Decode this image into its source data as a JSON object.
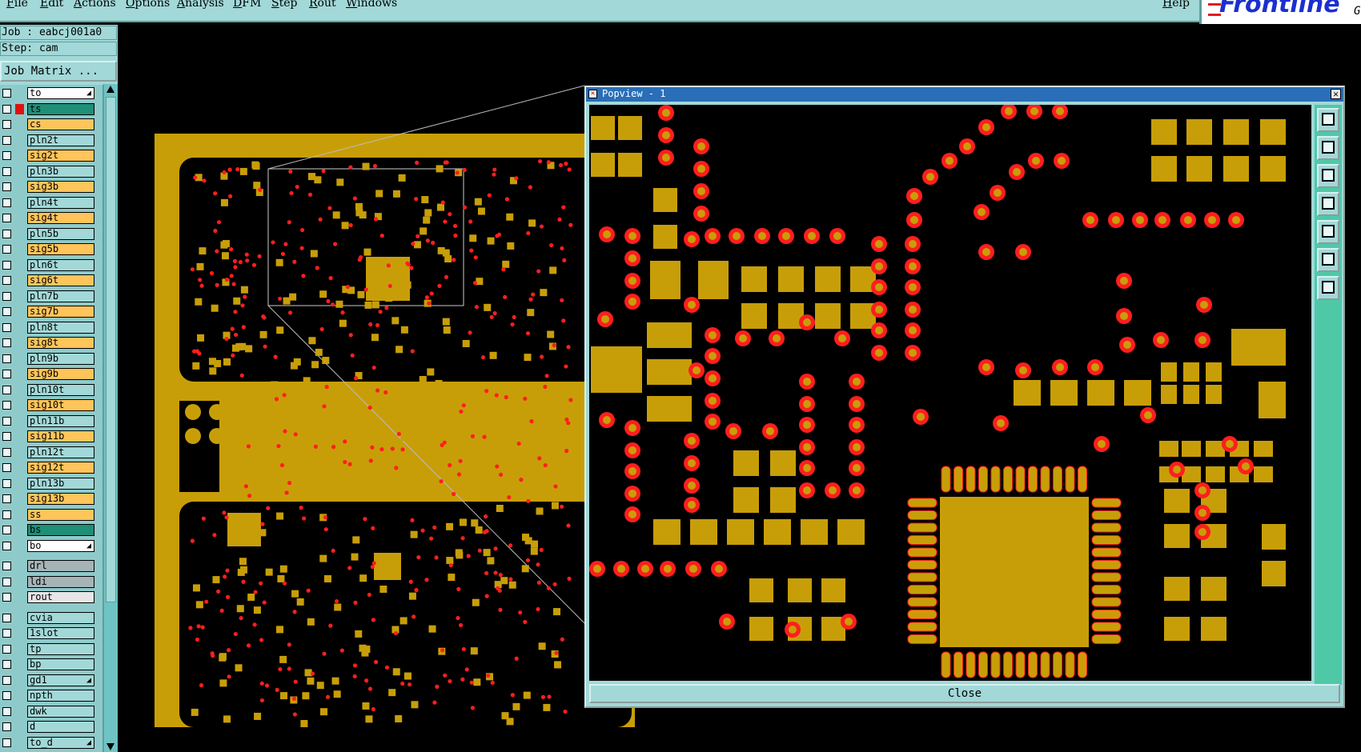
{
  "menubar": {
    "items": [
      "File",
      "Edit",
      "Actions",
      "Options",
      "Analysis",
      "DFM",
      "Step",
      "Rout",
      "Windows"
    ],
    "help": "Help"
  },
  "logo": {
    "text": "Frontline",
    "suffix": "G"
  },
  "job": {
    "label": "Job : eabcj001a0",
    "step": "Step: cam",
    "matrix_button": "Job Matrix ..."
  },
  "layers": [
    {
      "name": "to",
      "color": "white",
      "caret": true,
      "mark": ""
    },
    {
      "name": "ts",
      "color": "green",
      "caret": false,
      "mark": "red"
    },
    {
      "name": "cs",
      "color": "orange",
      "caret": false,
      "mark": ""
    },
    {
      "name": "pln2t",
      "color": "teal",
      "caret": false,
      "mark": ""
    },
    {
      "name": "sig2t",
      "color": "orange",
      "caret": false,
      "mark": ""
    },
    {
      "name": "pln3b",
      "color": "teal",
      "caret": false,
      "mark": ""
    },
    {
      "name": "sig3b",
      "color": "orange",
      "caret": false,
      "mark": ""
    },
    {
      "name": "pln4t",
      "color": "teal",
      "caret": false,
      "mark": ""
    },
    {
      "name": "sig4t",
      "color": "orange",
      "caret": false,
      "mark": ""
    },
    {
      "name": "pln5b",
      "color": "teal",
      "caret": false,
      "mark": ""
    },
    {
      "name": "sig5b",
      "color": "orange",
      "caret": false,
      "mark": ""
    },
    {
      "name": "pln6t",
      "color": "teal",
      "caret": false,
      "mark": ""
    },
    {
      "name": "sig6t",
      "color": "orange",
      "caret": false,
      "mark": ""
    },
    {
      "name": "pln7b",
      "color": "teal",
      "caret": false,
      "mark": ""
    },
    {
      "name": "sig7b",
      "color": "orange",
      "caret": false,
      "mark": ""
    },
    {
      "name": "pln8t",
      "color": "teal",
      "caret": false,
      "mark": ""
    },
    {
      "name": "sig8t",
      "color": "orange",
      "caret": false,
      "mark": ""
    },
    {
      "name": "pln9b",
      "color": "teal",
      "caret": false,
      "mark": ""
    },
    {
      "name": "sig9b",
      "color": "orange",
      "caret": false,
      "mark": ""
    },
    {
      "name": "pln10t",
      "color": "teal",
      "caret": false,
      "mark": ""
    },
    {
      "name": "sig10t",
      "color": "orange",
      "caret": false,
      "mark": ""
    },
    {
      "name": "pln11b",
      "color": "teal",
      "caret": false,
      "mark": ""
    },
    {
      "name": "sig11b",
      "color": "orange",
      "caret": false,
      "mark": ""
    },
    {
      "name": "pln12t",
      "color": "teal",
      "caret": false,
      "mark": ""
    },
    {
      "name": "sig12t",
      "color": "orange",
      "caret": false,
      "mark": ""
    },
    {
      "name": "pln13b",
      "color": "teal",
      "caret": false,
      "mark": ""
    },
    {
      "name": "sig13b",
      "color": "orange",
      "caret": false,
      "mark": ""
    },
    {
      "name": "ss",
      "color": "orange",
      "caret": false,
      "mark": ""
    },
    {
      "name": "bs",
      "color": "green",
      "caret": false,
      "mark": ""
    },
    {
      "name": "bo",
      "color": "white",
      "caret": true,
      "mark": ""
    },
    {
      "name": "drl",
      "color": "grey",
      "caret": false,
      "mark": "",
      "gap": true
    },
    {
      "name": "ldi",
      "color": "grey",
      "caret": false,
      "mark": ""
    },
    {
      "name": "rout",
      "color": "lightgrey",
      "caret": false,
      "mark": ""
    },
    {
      "name": "cvia",
      "color": "teal",
      "caret": false,
      "mark": "",
      "gap": true
    },
    {
      "name": "1slot",
      "color": "teal",
      "caret": false,
      "mark": ""
    },
    {
      "name": "tp",
      "color": "teal",
      "caret": false,
      "mark": ""
    },
    {
      "name": "bp",
      "color": "teal",
      "caret": false,
      "mark": ""
    },
    {
      "name": "gd1",
      "color": "teal",
      "caret": true,
      "mark": ""
    },
    {
      "name": "npth",
      "color": "teal",
      "caret": false,
      "mark": ""
    },
    {
      "name": "dwk",
      "color": "teal",
      "caret": false,
      "mark": ""
    },
    {
      "name": "d",
      "color": "teal",
      "caret": false,
      "mark": ""
    },
    {
      "name": "to_d",
      "color": "teal",
      "caret": true,
      "mark": ""
    }
  ],
  "popview": {
    "title": "Popview - 1",
    "close_label": "Close",
    "tools": [
      "zoom-window-icon",
      "zoom-in-icon",
      "zoom-out-icon",
      "pan-left-icon",
      "pan-right-icon",
      "fit-all-icon",
      "fit-window-icon"
    ]
  },
  "colors": {
    "copper": "#c89e08",
    "via": "#ff1e1e",
    "panel": "#a2d8d8",
    "board_bg": "#000000",
    "title_bar": "#2a6eb8"
  }
}
